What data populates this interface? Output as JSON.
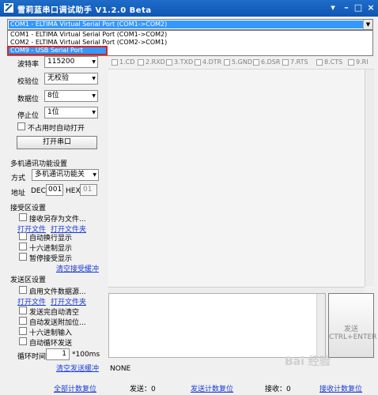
{
  "window": {
    "title": "雪莉蓝串口调试助手 V1.2.0 Beta",
    "buttons": [
      "▾",
      "–",
      "□",
      "×"
    ]
  },
  "port_combo": {
    "selected": "COM1 - ELTIMA Virtual Serial Port (COM1->COM2)",
    "options": [
      "COM1 - ELTIMA Virtual Serial Port (COM1->COM2)",
      "COM2 - ELTIMA Virtual Serial Port (COM2->COM1)",
      "COM9 - USB Serial Port"
    ],
    "highlighted_index": 2
  },
  "serial_settings": {
    "baud_label": "波特率",
    "baud_value": "115200",
    "parity_label": "校验位",
    "parity_value": "无校验",
    "databits_label": "数据位",
    "databits_value": "8位",
    "stopbits_label": "停止位",
    "stopbits_value": "1位",
    "auto_open_label": "不占用时自动打开",
    "open_button": "打开串口"
  },
  "pins": [
    "1.CD",
    "2.RXD",
    "3.TXD",
    "4.DTR",
    "5.GND",
    "6.DSR",
    "7.RTS",
    "8.CTS",
    "9.RI"
  ],
  "multi_comm": {
    "section_title": "多机通讯功能设置",
    "mode_label": "方式",
    "mode_value": "多机通讯功能关",
    "address_label": "地址",
    "dec_label": "DEC",
    "dec_value": "001",
    "hex_label": "HEX",
    "hex_value": "01"
  },
  "receive": {
    "section_title": "接受区设置",
    "save_as_file": "接收另存为文件...",
    "open_file": "打开文件",
    "open_folder": "打开文件夹",
    "auto_newline": "自动换行显示",
    "hex_display": "十六进制显示",
    "pause_receive": "暂停接受显示",
    "clear_receive": "清空接受缓冲"
  },
  "send": {
    "section_title": "发送区设置",
    "enable_file_source": "启用文件数据源...",
    "open_file": "打开文件",
    "open_folder": "打开文件夹",
    "clear_after_send": "发送完自动清空",
    "append_checksum": "自动发送附加位...",
    "hex_input": "十六进制输入",
    "loop_send": "自动循环发送",
    "loop_period_label": "循环时间",
    "loop_period_value": "1",
    "loop_period_unit": "*100ms",
    "clear_send": "清空发送缓冲",
    "send_button_line1": "发送",
    "send_button_line2": "CTRL+ENTER",
    "checksum_mode": "NONE"
  },
  "statusbar": {
    "reset_all": "全部计数复位",
    "sent_label": "发送：0",
    "reset_sent": "发送计数复位",
    "received_label": "接收：0",
    "reset_received": "接收计数复位"
  },
  "watermark": "Bai 经验"
}
